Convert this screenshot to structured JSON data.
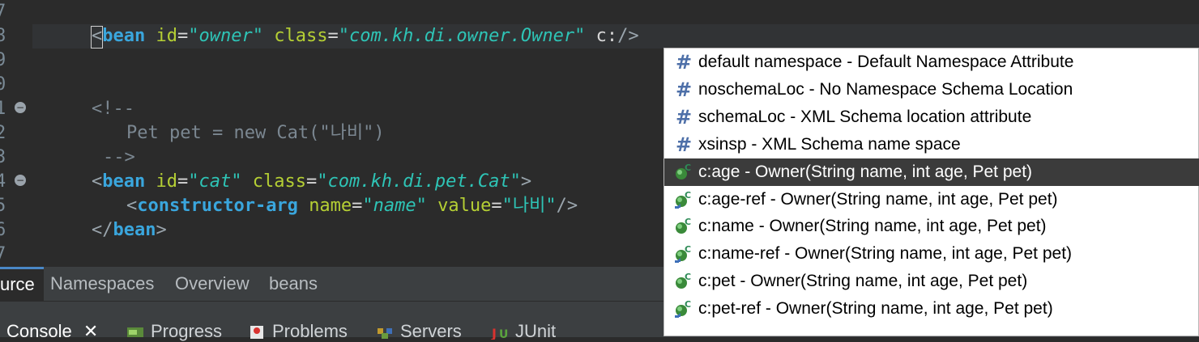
{
  "gutter": {
    "line_numbers": [
      "7",
      "8",
      "9",
      "0",
      "1",
      "2",
      "3",
      "4",
      "5",
      "6",
      "7"
    ],
    "fold_markers": [
      "1",
      "4"
    ]
  },
  "editor": {
    "line8": {
      "open": "<",
      "tag": "bean",
      "attr1": "id",
      "eq": "=",
      "q": "\"",
      "val1": "owner",
      "attr2": "class",
      "val2": "com.kh.di.owner.Owner",
      "attr3": "c:",
      "close": "/>"
    },
    "comment_open": "<!--",
    "comment_body": "Pet pet = new Cat(\"나비\")",
    "comment_close": "-->",
    "line14": {
      "tag": "bean",
      "attr1": "id",
      "val1": "cat",
      "attr2": "class",
      "val2": "com.kh.di.pet.Cat",
      "end": ">"
    },
    "line15": {
      "tag": "constructor-arg",
      "attr1": "name",
      "val1": "name",
      "attr2": "value",
      "val2": "나비",
      "end": "/>"
    },
    "line16": {
      "open": "</",
      "tag": "bean",
      "end": ">"
    }
  },
  "editor_tabs": [
    {
      "label": "urce",
      "active": true
    },
    {
      "label": "Namespaces",
      "active": false
    },
    {
      "label": "Overview",
      "active": false
    },
    {
      "label": "beans",
      "active": false
    }
  ],
  "views": [
    {
      "label": "Console",
      "icon": "console-icon"
    },
    {
      "label": "Progress",
      "icon": "progress-icon"
    },
    {
      "label": "Problems",
      "icon": "problems-icon"
    },
    {
      "label": "Servers",
      "icon": "servers-icon"
    },
    {
      "label": "JUnit",
      "icon": "junit-icon"
    }
  ],
  "console_close": "✕",
  "autocomplete": {
    "items": [
      {
        "label": "default namespace - Default Namespace Attribute",
        "icon": "hash-icon",
        "selected": false
      },
      {
        "label": "noschemaLoc - No Namespace Schema Location",
        "icon": "hash-icon",
        "selected": false
      },
      {
        "label": "schemaLoc - XML Schema location attribute",
        "icon": "hash-icon",
        "selected": false
      },
      {
        "label": "xsinsp - XML Schema name space",
        "icon": "hash-icon",
        "selected": false
      },
      {
        "label": "c:age - Owner(String name, int age, Pet pet)",
        "icon": "constructor-arg-icon",
        "selected": true
      },
      {
        "label": "c:age-ref - Owner(String name, int age, Pet pet)",
        "icon": "constructor-ref-icon",
        "selected": false
      },
      {
        "label": "c:name - Owner(String name, int age, Pet pet)",
        "icon": "constructor-arg-icon",
        "selected": false
      },
      {
        "label": "c:name-ref - Owner(String name, int age, Pet pet)",
        "icon": "constructor-ref-icon",
        "selected": false
      },
      {
        "label": "c:pet - Owner(String name, int age, Pet pet)",
        "icon": "constructor-arg-icon",
        "selected": false
      },
      {
        "label": "c:pet-ref - Owner(String name, int age, Pet pet)",
        "icon": "constructor-ref-icon",
        "selected": false
      }
    ]
  },
  "colors": {
    "editor_bg": "#2b2b2b",
    "tag": "#3aa6dd",
    "attribute": "#b5cf34",
    "value": "#2ec4b6",
    "comment": "#7b8791",
    "popup_selection": "#3b3b3b",
    "constructor_icon": "#3a8a3a"
  }
}
